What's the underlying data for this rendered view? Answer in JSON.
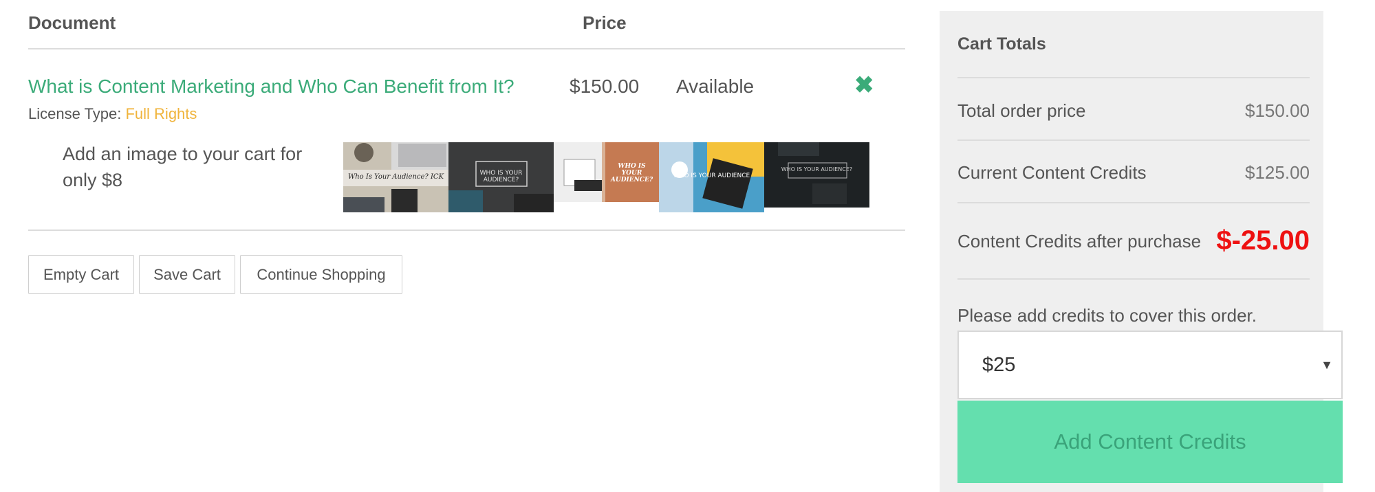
{
  "table": {
    "header_document": "Document",
    "header_price": "Price"
  },
  "item": {
    "title": "What is Content Marketing and Who Can Benefit from It?",
    "price": "$150.00",
    "status": "Available",
    "license_label": "License Type:",
    "license_value": "Full Rights",
    "remove_icon": "close-icon",
    "accent_color": "#3bab79",
    "license_color": "#f0b43c"
  },
  "upsell": {
    "text": "Add an image to your cart for only $8",
    "thumbnails": [
      {
        "caption": "Who Is Your Audience? ICK"
      },
      {
        "caption": "WHO IS YOUR AUDIENCE?"
      },
      {
        "caption": "WHO IS YOUR AUDIENCE?"
      },
      {
        "caption": "WHO IS YOUR AUDIENCE"
      },
      {
        "caption": "WHO IS YOUR AUDIENCE?"
      }
    ]
  },
  "actions": {
    "empty_cart": "Empty Cart",
    "save_cart": "Save Cart",
    "continue_shopping": "Continue Shopping"
  },
  "cart_totals": {
    "title": "Cart Totals",
    "total_order_label": "Total order price",
    "total_order_value": "$150.00",
    "current_credits_label": "Current Content Credits",
    "current_credits_value": "$125.00",
    "after_purchase_label": "Content Credits after purchase",
    "after_purchase_value": "$-25.00",
    "note": "Please add credits to cover this order.",
    "credit_select_value": "$25",
    "add_button": "Add Content Credits",
    "negative_color": "#ee1111",
    "button_color": "#64dfae"
  }
}
